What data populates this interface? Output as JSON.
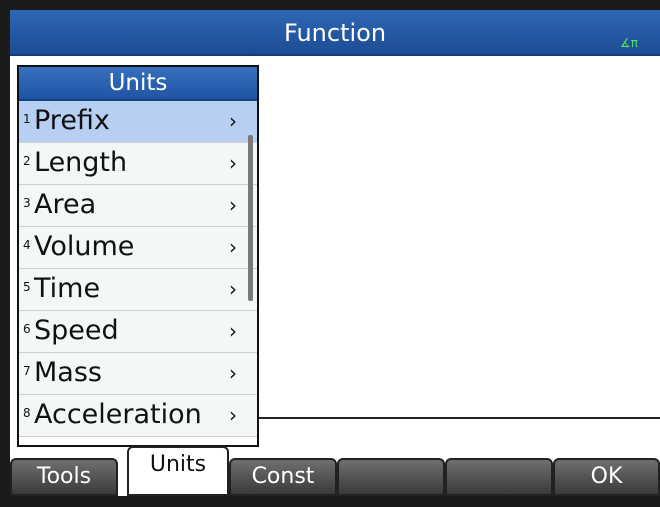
{
  "header": {
    "title": "Function",
    "angle_mode": "∡π"
  },
  "menu": {
    "title": "Units",
    "items": [
      {
        "number": "1",
        "label": "Prefix",
        "chevron": "›",
        "selected": true
      },
      {
        "number": "2",
        "label": "Length",
        "chevron": "›"
      },
      {
        "number": "3",
        "label": "Area",
        "chevron": "›"
      },
      {
        "number": "4",
        "label": "Volume",
        "chevron": "›"
      },
      {
        "number": "5",
        "label": "Time",
        "chevron": "›"
      },
      {
        "number": "6",
        "label": "Speed",
        "chevron": "›"
      },
      {
        "number": "7",
        "label": "Mass",
        "chevron": "›"
      },
      {
        "number": "8",
        "label": "Acceleration",
        "chevron": "›"
      }
    ]
  },
  "softkeys": [
    {
      "label": "Tools"
    },
    {
      "label": "Units",
      "active": true
    },
    {
      "label": "Const"
    },
    {
      "label": ""
    },
    {
      "label": ""
    },
    {
      "label": "OK"
    }
  ],
  "colors": {
    "title_bar": "#2f67b3",
    "selected_row": "#b6cff2",
    "angle_indicator": "#55e35a"
  }
}
